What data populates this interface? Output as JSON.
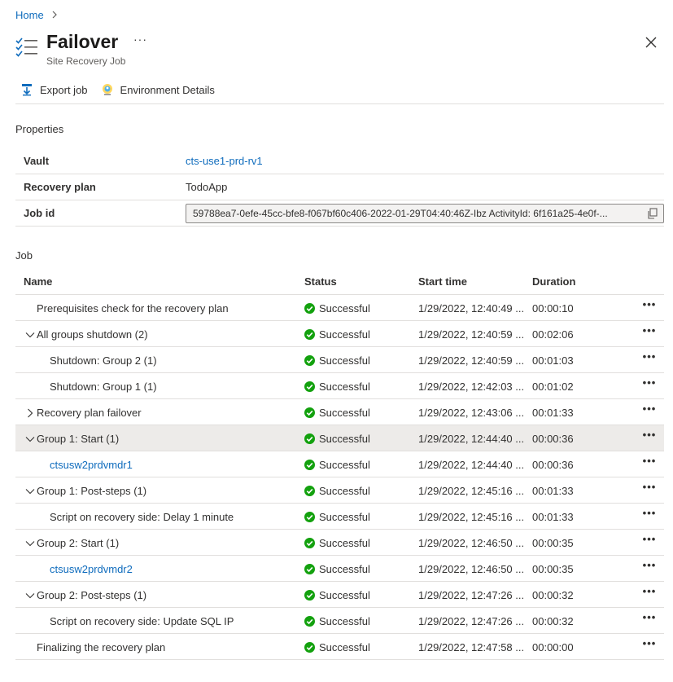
{
  "breadcrumb": {
    "home": "Home"
  },
  "header": {
    "title": "Failover",
    "subtitle": "Site Recovery Job",
    "more": "···",
    "icon": "checklist-icon"
  },
  "toolbar": {
    "export_label": "Export job",
    "env_label": "Environment Details"
  },
  "properties": {
    "heading": "Properties",
    "vault_key": "Vault",
    "vault_value": "cts-use1-prd-rv1",
    "plan_key": "Recovery plan",
    "plan_value": "TodoApp",
    "jobid_key": "Job id",
    "jobid_value": "59788ea7-0efe-45cc-bfe8-f067bf60c406-2022-01-29T04:40:46Z-Ibz ActivityId: 6f161a25-4e0f-..."
  },
  "job": {
    "heading": "Job",
    "columns": {
      "name": "Name",
      "status": "Status",
      "start": "Start time",
      "duration": "Duration"
    },
    "more": "•••",
    "rows": [
      {
        "name": "Prerequisites check for the recovery plan",
        "status": "Successful",
        "start": "1/29/2022, 12:40:49 ...",
        "duration": "00:00:10"
      },
      {
        "name": "All groups shutdown (2)",
        "status": "Successful",
        "start": "1/29/2022, 12:40:59 ...",
        "duration": "00:02:06"
      },
      {
        "name": "Shutdown: Group 2 (1)",
        "status": "Successful",
        "start": "1/29/2022, 12:40:59 ...",
        "duration": "00:01:03"
      },
      {
        "name": "Shutdown: Group 1 (1)",
        "status": "Successful",
        "start": "1/29/2022, 12:42:03 ...",
        "duration": "00:01:02"
      },
      {
        "name": "Recovery plan failover",
        "status": "Successful",
        "start": "1/29/2022, 12:43:06 ...",
        "duration": "00:01:33"
      },
      {
        "name": "Group 1: Start (1)",
        "status": "Successful",
        "start": "1/29/2022, 12:44:40 ...",
        "duration": "00:00:36"
      },
      {
        "name": "ctsusw2prdvmdr1",
        "status": "Successful",
        "start": "1/29/2022, 12:44:40 ...",
        "duration": "00:00:36"
      },
      {
        "name": "Group 1: Post-steps (1)",
        "status": "Successful",
        "start": "1/29/2022, 12:45:16 ...",
        "duration": "00:01:33"
      },
      {
        "name": "Script on recovery side: Delay 1 minute",
        "status": "Successful",
        "start": "1/29/2022, 12:45:16 ...",
        "duration": "00:01:33"
      },
      {
        "name": "Group 2: Start (1)",
        "status": "Successful",
        "start": "1/29/2022, 12:46:50 ...",
        "duration": "00:00:35"
      },
      {
        "name": "ctsusw2prdvmdr2",
        "status": "Successful",
        "start": "1/29/2022, 12:46:50 ...",
        "duration": "00:00:35"
      },
      {
        "name": "Group 2: Post-steps (1)",
        "status": "Successful",
        "start": "1/29/2022, 12:47:26 ...",
        "duration": "00:00:32"
      },
      {
        "name": "Script on recovery side: Update SQL IP",
        "status": "Successful",
        "start": "1/29/2022, 12:47:26 ...",
        "duration": "00:00:32"
      },
      {
        "name": "Finalizing the recovery plan",
        "status": "Successful",
        "start": "1/29/2022, 12:47:58 ...",
        "duration": "00:00:00"
      }
    ]
  },
  "colors": {
    "link": "#0f6cbd",
    "success": "#13a10e",
    "selected_row": "#edebe9"
  }
}
